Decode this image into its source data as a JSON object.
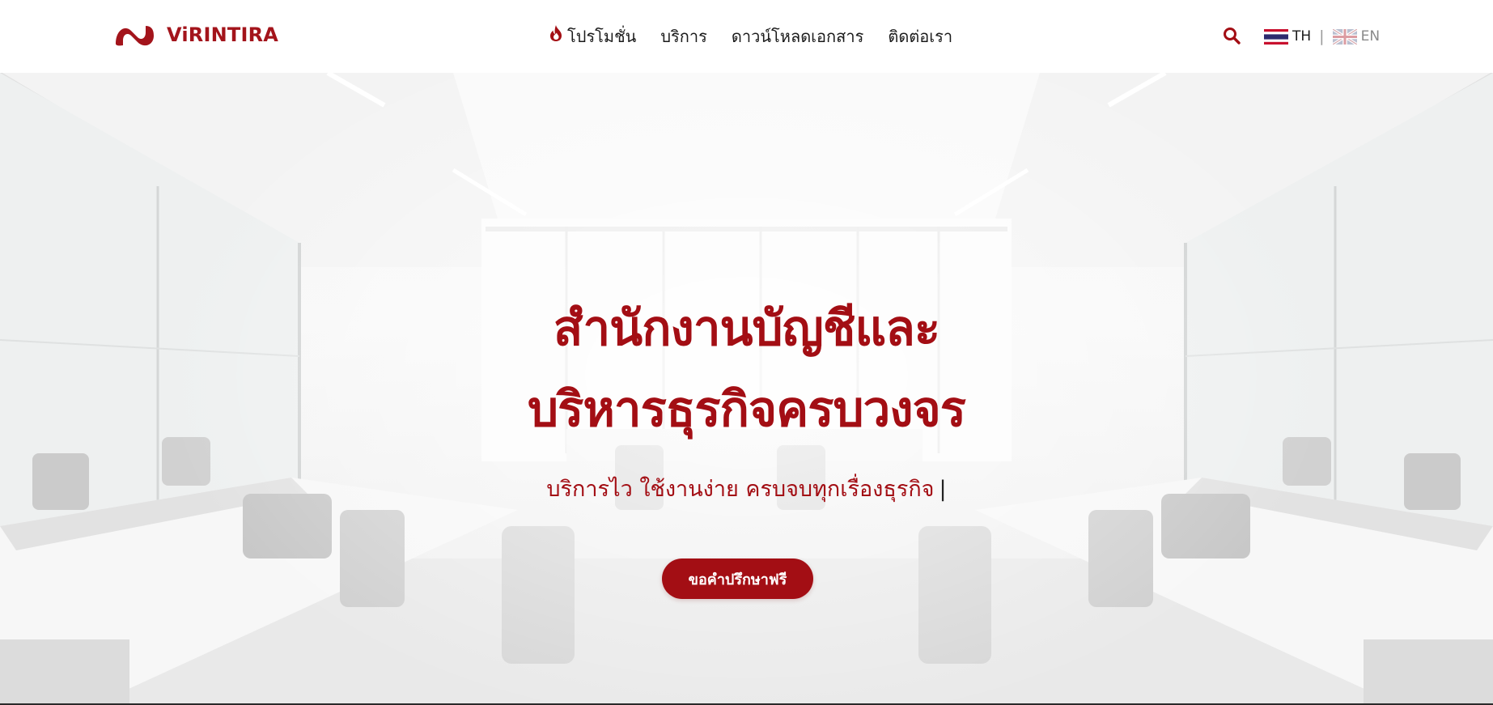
{
  "header": {
    "brand": "ViRINTIRA",
    "nav": [
      {
        "label": "โปรโมชั่น",
        "icon": "flame-icon"
      },
      {
        "label": "บริการ"
      },
      {
        "label": "ดาวน์โหลดเอกสาร"
      },
      {
        "label": "ติดต่อเรา"
      }
    ],
    "search_icon": "search-icon",
    "languages": {
      "th_label": "TH",
      "separator": "|",
      "en_label": "EN"
    }
  },
  "hero": {
    "title_line1": "สำนักงานบัญชีและ",
    "title_line2": "บริหารธุรกิจครบวงจร",
    "subtitle": "บริการไว ใช้งานง่าย ครบจบทุกเรื่องธุรกิจ",
    "caret": "|",
    "cta_label": "ขอคำปรึกษาฟรี"
  },
  "colors": {
    "brand_red": "#a30e14",
    "header_bg": "#ffffff",
    "text_dark": "#1b1b1b"
  }
}
